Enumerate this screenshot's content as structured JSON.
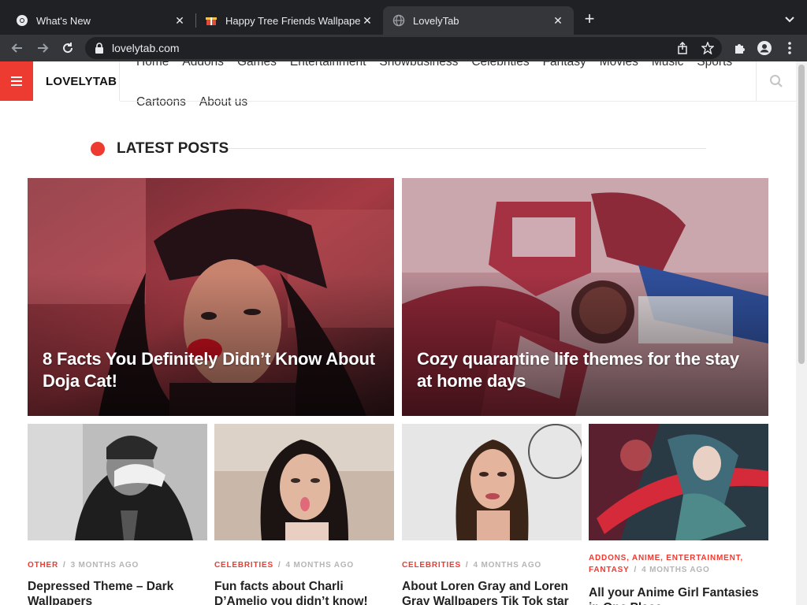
{
  "browser": {
    "tabs": [
      {
        "title": "What's New"
      },
      {
        "title": "Happy Tree Friends Wallpapers"
      },
      {
        "title": "LovelyTab"
      }
    ],
    "url": "lovelytab.com"
  },
  "site": {
    "brand": "LOVELYTAB",
    "nav_row1": [
      "Home",
      "Addons",
      "Games",
      "Entertainment",
      "Showbusiness",
      "Celebrities",
      "Fantasy",
      "Movies",
      "Music",
      "Sports"
    ],
    "nav_row2": [
      "Cartoons",
      "About us"
    ],
    "section_title": "LATEST POSTS"
  },
  "featured": [
    {
      "title": "8 Facts You Definitely Didn’t Know About Doja Cat!"
    },
    {
      "title": "Cozy quarantine life themes for the stay at home days"
    }
  ],
  "cards": [
    {
      "categories": "OTHER",
      "ago": "3 MONTHS AGO",
      "title": "Depressed Theme – Dark Wallpapers"
    },
    {
      "categories": "CELEBRITIES",
      "ago": "4 MONTHS AGO",
      "title": "Fun facts about Charli D’Amelio you didn’t know!"
    },
    {
      "categories": "CELEBRITIES",
      "ago": "4 MONTHS AGO",
      "title": "About Loren Gray and Loren Gray Wallpapers Tik Tok star"
    },
    {
      "categories": "ADDONS, ANIME, ENTERTAINMENT, FANTASY",
      "ago": "4 MONTHS AGO",
      "title": "All your Anime Girl Fantasies in One Place"
    }
  ],
  "colors": {
    "accent": "#ee3b32",
    "chrome_dark": "#202124",
    "chrome_toolbar": "#35363a"
  }
}
